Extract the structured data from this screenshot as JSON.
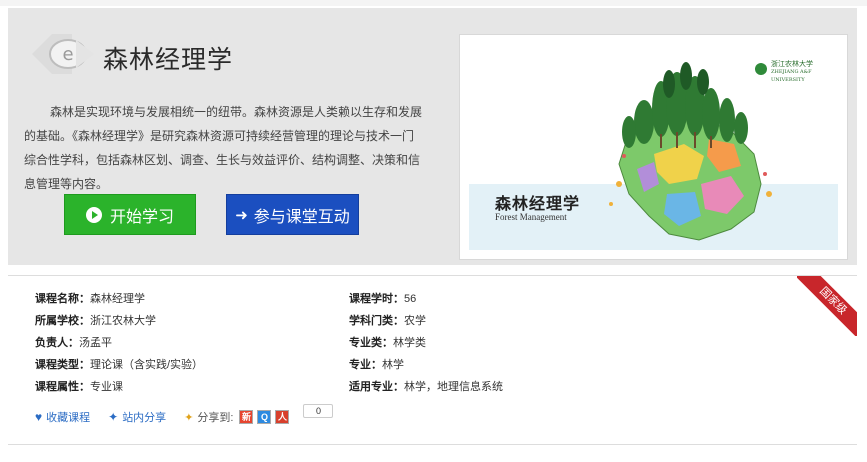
{
  "course": {
    "title": "森林经理学",
    "description": "森林是实现环境与发展相统一的纽带。森林资源是人类赖以生存和发展的基础。《森林经理学》是研究森林资源可持续经营管理的理论与技术一门综合性学科，包括森林区划、调查、生长与效益评价、结构调整、决策和信息管理等内容。",
    "start_button": "开始学习",
    "interact_button": "参与课堂互动"
  },
  "cover": {
    "title_cn": "森林经理学",
    "title_en": "Forest Management",
    "university_cn": "浙江农林大学",
    "university_en": "ZHEJIANG A&F UNIVERSITY"
  },
  "badge": "国家级",
  "details": {
    "left": [
      {
        "label": "课程名称：",
        "value": "森林经理学"
      },
      {
        "label": "所属学校：",
        "value": "浙江农林大学"
      },
      {
        "label": "负责人：",
        "value": "汤孟平"
      },
      {
        "label": "课程类型：",
        "value": "理论课（含实践/实验）"
      },
      {
        "label": "课程属性：",
        "value": "专业课"
      }
    ],
    "right": [
      {
        "label": "课程学时：",
        "value": "56"
      },
      {
        "label": "学科门类：",
        "value": "农学"
      },
      {
        "label": "专业类：",
        "value": "林学类"
      },
      {
        "label": "专业：",
        "value": "林学"
      },
      {
        "label": "适用专业：",
        "value": "林学，地理信息系统"
      }
    ]
  },
  "actions": {
    "favorite": "收藏课程",
    "site_share": "站内分享",
    "share_to": "分享到:",
    "share_count": "0"
  },
  "colors": {
    "start_green": "#2bb32b",
    "interact_blue": "#1b4fc0",
    "badge_red": "#c8262b",
    "link_blue": "#2b6cc4"
  }
}
